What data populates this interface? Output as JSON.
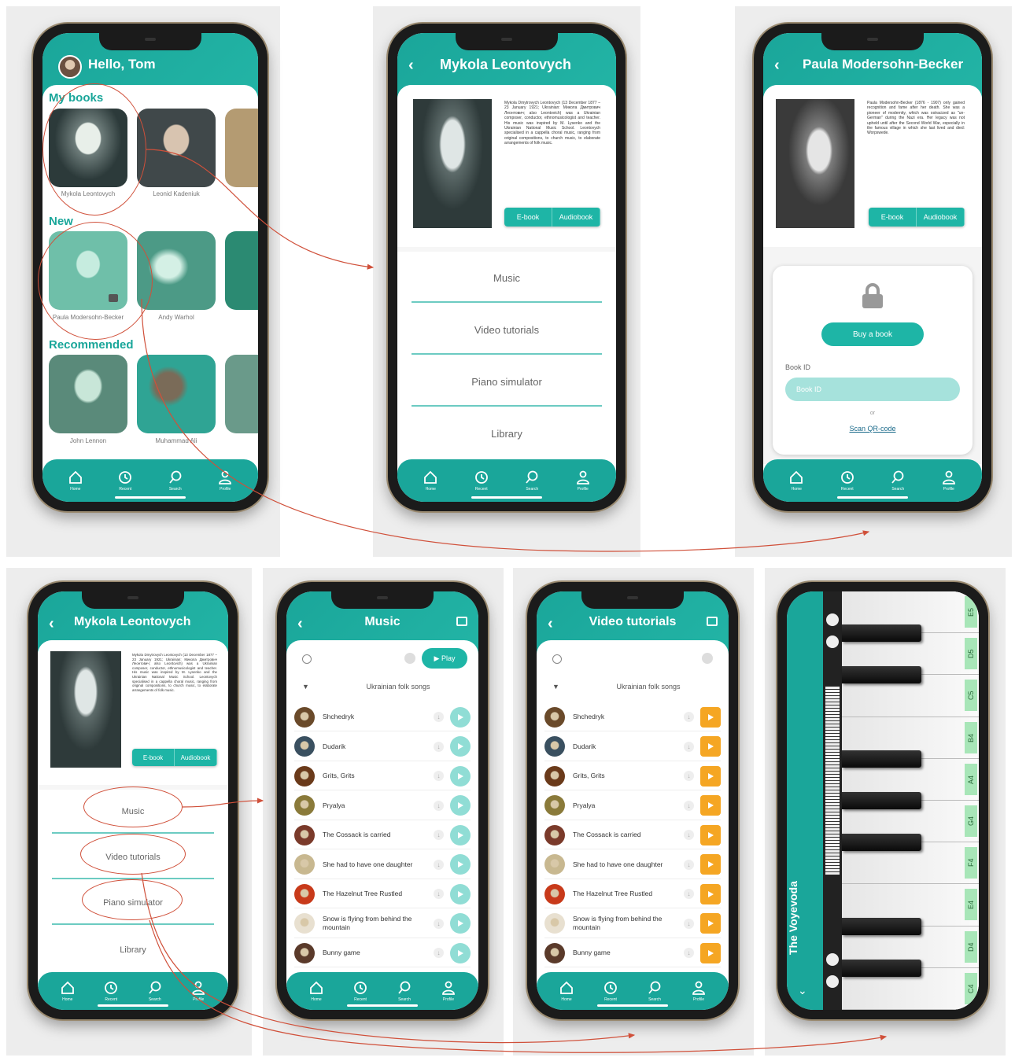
{
  "home": {
    "greeting": "Hello, Tom",
    "sections": [
      "My books",
      "New",
      "Recommended"
    ],
    "my_books": [
      "Mykola Leontovych",
      "Leonid Kadeniuk"
    ],
    "new_books": [
      "Paula Modersohn-Becker",
      "Andy Warhol"
    ],
    "recommended": [
      "John Lennon",
      "Muhammad Ali"
    ]
  },
  "tabs": [
    "Home",
    "Recent",
    "Search",
    "Profile"
  ],
  "leontovych": {
    "title": "Mykola Leontovych",
    "bio": "Mykola Dmytrovych Leontovych (13 December 1877 – 23 January 1921; Ukrainian: Микола Дмитрович Леонтович; also Leontovich) was a Ukrainian composer, conductor, ethnomusicologist and teacher. His music was inspired by M. Lysenko and the Ukrainian National Music School. Leontovych specialised in a cappella choral music, ranging from original compositions, to church music, to elaborate arrangements of folk music.",
    "ebook": "E-book",
    "audiobook": "Audiobook",
    "menu": [
      "Music",
      "Video tutorials",
      "Piano simulator",
      "Library"
    ]
  },
  "paula": {
    "title": "Paula Modersohn-Becker",
    "bio": "Paula Modersohn-Becker (1876 - 1907) only gained recognition and fame after her death. She was a pioneer of modernity, which was ostracized as \"un-German\" during the Nazi era. Her legacy was not upheld until after the Second World War, especially in the famous village in which she last lived and died: Worpswede.",
    "ebook": "E-book",
    "audiobook": "Audiobook",
    "buy": "Buy a book",
    "book_id_label": "Book ID",
    "book_id_placeholder": "Book ID",
    "or": "or",
    "scan": "Scan QR-code"
  },
  "music": {
    "title": "Music",
    "play": "Play",
    "playlist": "Ukrainian folk songs",
    "songs": [
      "Shchedryk",
      "Dudarik",
      "Grits, Grits",
      "Pryalya",
      "The Cossack is carried",
      "She had to have one daughter",
      "The Hazelnut Tree Rustled",
      "Snow is flying from behind the mountain",
      "Bunny game"
    ]
  },
  "video": {
    "title": "Video tutorials",
    "playlist": "Ukrainian folk songs"
  },
  "piano": {
    "title": "The Voyevoda",
    "keys": [
      "E5",
      "D5",
      "C5",
      "B4",
      "A4",
      "G4",
      "F4",
      "E4",
      "D4",
      "C4"
    ]
  },
  "colors": {
    "teal": "#1aa69a",
    "orange": "#f5a623",
    "annotation": "#d0503a"
  }
}
